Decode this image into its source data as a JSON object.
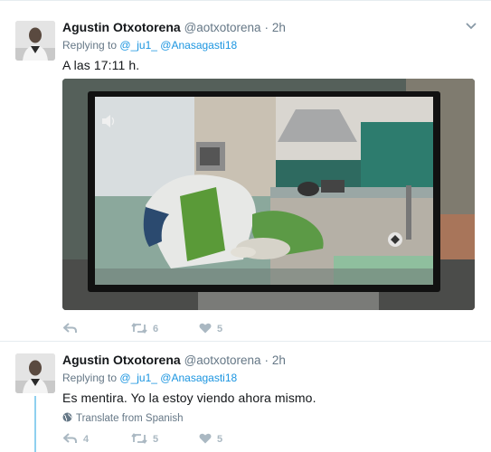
{
  "tweets": [
    {
      "fullname": "Agustin Otxotorena",
      "handle": "@aotxotorena",
      "dot": "·",
      "time": "2h",
      "replying_prefix": "Replying to",
      "reply_handle_1": "@_ju1_",
      "reply_handle_2": "@Anasagasti18",
      "text": "A las 17:11 h.",
      "reply_count": "",
      "retweet_count": "6",
      "like_count": "5"
    },
    {
      "fullname": "Agustin Otxotorena",
      "handle": "@aotxotorena",
      "dot": "·",
      "time": "2h",
      "replying_prefix": "Replying to",
      "reply_handle_1": "@_ju1_",
      "reply_handle_2": "@Anasagasti18",
      "text": "Es mentira. Yo la estoy viendo ahora mismo.",
      "translate": "Translate from Spanish",
      "reply_count": "4",
      "retweet_count": "5",
      "like_count": "5"
    }
  ],
  "colors": {
    "link": "#1b95e0",
    "muted": "#657786",
    "action_icon": "#aab8c2",
    "thread_line": "#8fd0ef"
  },
  "icons": [
    "caret-down-icon",
    "reply-icon",
    "retweet-icon",
    "heart-icon",
    "globe-icon",
    "volume-icon"
  ]
}
